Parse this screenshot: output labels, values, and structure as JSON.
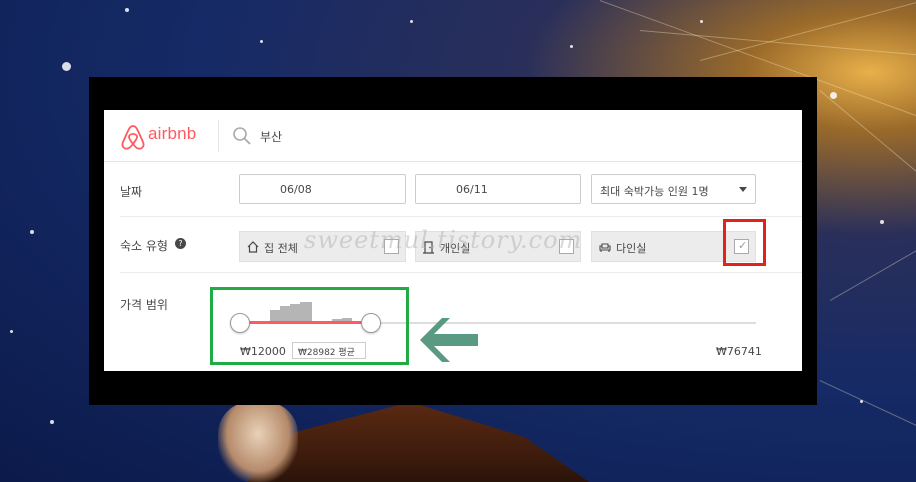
{
  "brand": {
    "name": "airbnb",
    "color": "#ff5a5f"
  },
  "search": {
    "query": "부산"
  },
  "date_row": {
    "label": "날짜",
    "checkin": "06/08",
    "checkout": "06/11",
    "guests": "최대 숙박가능 인원 1명"
  },
  "room_type_row": {
    "label": "숙소 유형",
    "help": "?",
    "options": [
      {
        "label": "집 전체",
        "icon": "home-icon",
        "checked": false
      },
      {
        "label": "개인실",
        "icon": "door-icon",
        "checked": false
      },
      {
        "label": "다인실",
        "icon": "sofa-icon",
        "checked": true
      }
    ],
    "checkmark": "✓"
  },
  "watermark": "sweetmul.tistory.com",
  "price_row": {
    "label": "가격 범위",
    "min": "₩12000",
    "max": "₩76741",
    "average": "₩28982 평균"
  },
  "annotation_colors": {
    "red_box": "#e2231a",
    "green_box": "#22aa44",
    "arrow": "#5a9a82"
  }
}
